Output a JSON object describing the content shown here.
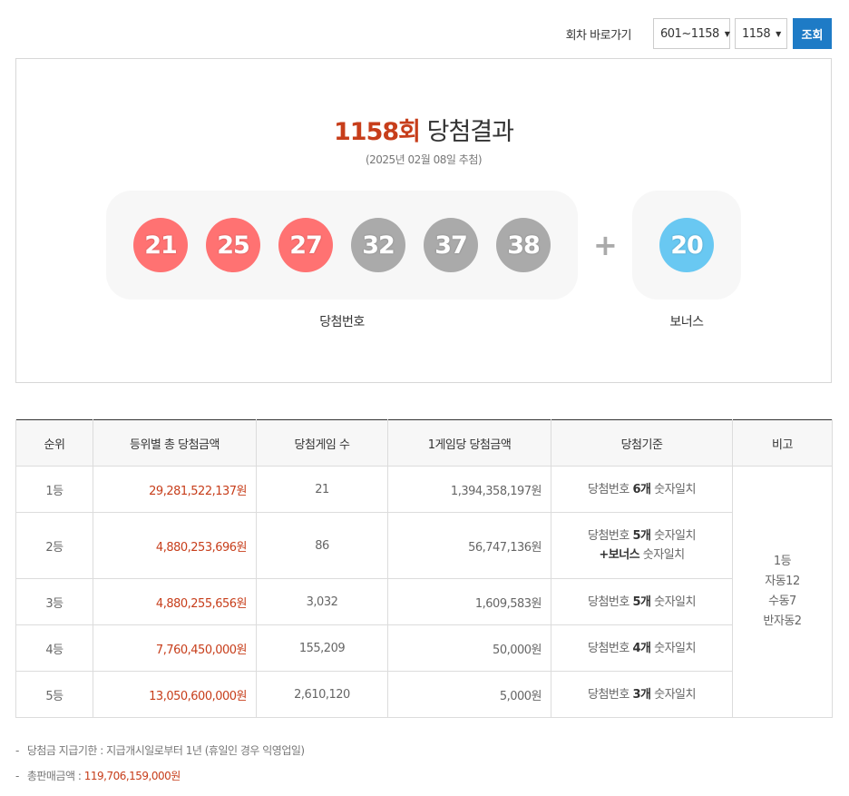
{
  "nav": {
    "label": "회차 바로가기",
    "range_value": "601~1158",
    "round_value": "1158",
    "search_label": "조회"
  },
  "result": {
    "round_number": "1158회",
    "title_suffix": "당첨결과",
    "date": "(2025년 02월 08일 추첨)",
    "numbers": [
      "21",
      "25",
      "27",
      "32",
      "37",
      "38"
    ],
    "number_colors": [
      "#ff7272",
      "#ff7272",
      "#ff7272",
      "#aaaaaa",
      "#aaaaaa",
      "#aaaaaa"
    ],
    "plus": "+",
    "bonus": "20",
    "bonus_color": "#69c8f2",
    "numbers_caption": "당첨번호",
    "bonus_caption": "보너스"
  },
  "table": {
    "headers": [
      "순위",
      "등위별 총 당첨금액",
      "당첨게임 수",
      "1게임당 당첨금액",
      "당첨기준",
      "비고"
    ],
    "rows": [
      {
        "rank": "1등",
        "total": "29,281,522,137원",
        "games": "21",
        "per_game": "1,394,358,197원",
        "crit_pre": "당첨번호 ",
        "crit_bold": "6개",
        "crit_post": " 숫자일치",
        "crit_line2_bold": "",
        "crit_line2_post": ""
      },
      {
        "rank": "2등",
        "total": "4,880,253,696원",
        "games": "86",
        "per_game": "56,747,136원",
        "crit_pre": "당첨번호 ",
        "crit_bold": "5개",
        "crit_post": " 숫자일치",
        "crit_line2_bold": "+보너스",
        "crit_line2_post": " 숫자일치"
      },
      {
        "rank": "3등",
        "total": "4,880,255,656원",
        "games": "3,032",
        "per_game": "1,609,583원",
        "crit_pre": "당첨번호 ",
        "crit_bold": "5개",
        "crit_post": " 숫자일치",
        "crit_line2_bold": "",
        "crit_line2_post": ""
      },
      {
        "rank": "4등",
        "total": "7,760,450,000원",
        "games": "155,209",
        "per_game": "50,000원",
        "crit_pre": "당첨번호 ",
        "crit_bold": "4개",
        "crit_post": " 숫자일치",
        "crit_line2_bold": "",
        "crit_line2_post": ""
      },
      {
        "rank": "5등",
        "total": "13,050,600,000원",
        "games": "2,610,120",
        "per_game": "5,000원",
        "crit_pre": "당첨번호 ",
        "crit_bold": "3개",
        "crit_post": " 숫자일치",
        "crit_line2_bold": "",
        "crit_line2_post": ""
      }
    ],
    "note_lines": [
      "1등",
      "자동12",
      "수동7",
      "반자동2"
    ]
  },
  "notes": {
    "dash": "-",
    "deadline": "당첨금 지급기한 : 지급개시일로부터 1년 (휴일인 경우 익영업일)",
    "sales_label": "총판매금액 : ",
    "sales_amount": "119,706,159,000원"
  }
}
